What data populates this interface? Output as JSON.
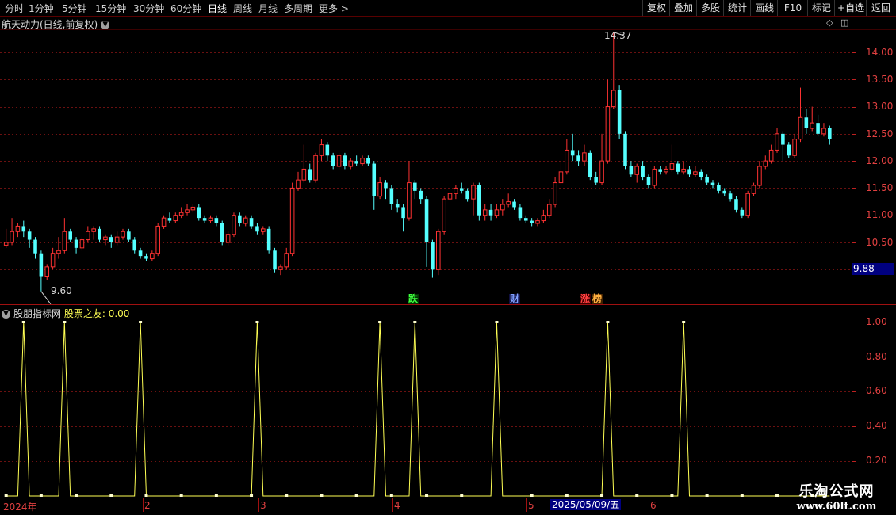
{
  "toolbar": {
    "periods": [
      "分时",
      "1分钟",
      "5分钟",
      "15分钟",
      "30分钟",
      "60分钟",
      "日线",
      "周线",
      "月线",
      "多周期",
      "更多 >"
    ],
    "active_period": "日线",
    "right_buttons": [
      "复权",
      "叠加",
      "多股",
      "统计",
      "画线",
      "F10",
      "标记",
      "+自选",
      "返回"
    ]
  },
  "main_chart": {
    "title": "航天动力(日线,前复权)",
    "price_axis": [
      "14.00",
      "13.50",
      "13.00",
      "12.50",
      "12.00",
      "11.50",
      "11.00",
      "10.50"
    ],
    "current_price": "9.88",
    "high_label": "14.37",
    "low_label": "9.60",
    "markers": [
      {
        "text": "跌",
        "color": "#40ff40",
        "bg": "#003300"
      },
      {
        "text": "财",
        "color": "#80a0ff",
        "bg": "#101040"
      },
      {
        "text": "涨",
        "color": "#ff4040",
        "bg": "#400000"
      },
      {
        "text": "榜",
        "color": "#ffb040",
        "bg": "#402000"
      }
    ]
  },
  "chart_data": [
    {
      "type": "candlestick",
      "title": "航天动力(日线,前复权)",
      "ylim": [
        9.5,
        14.5
      ],
      "up_color": "#ff3232",
      "down_color": "#54ffff",
      "candles": [
        [
          10.45,
          10.5,
          10.75,
          10.4
        ],
        [
          10.5,
          10.7,
          10.95,
          10.45
        ],
        [
          10.7,
          10.8,
          10.85,
          10.6
        ],
        [
          10.8,
          10.7,
          10.9,
          10.6
        ],
        [
          10.7,
          10.55,
          10.75,
          10.4
        ],
        [
          10.55,
          10.3,
          10.6,
          10.2
        ],
        [
          10.3,
          9.88,
          10.35,
          9.6
        ],
        [
          9.88,
          10.05,
          10.1,
          9.8
        ],
        [
          10.05,
          10.3,
          10.4,
          10.0
        ],
        [
          10.3,
          10.35,
          10.6,
          10.2
        ],
        [
          10.35,
          10.7,
          10.95,
          10.3
        ],
        [
          10.7,
          10.55,
          10.75,
          10.5
        ],
        [
          10.55,
          10.4,
          10.6,
          10.3
        ],
        [
          10.4,
          10.55,
          10.6,
          10.35
        ],
        [
          10.55,
          10.7,
          10.8,
          10.5
        ],
        [
          10.7,
          10.75,
          10.8,
          10.55
        ],
        [
          10.75,
          10.55,
          10.8,
          10.5
        ],
        [
          10.55,
          10.6,
          10.65,
          10.45
        ],
        [
          10.6,
          10.5,
          10.65,
          10.4
        ],
        [
          10.5,
          10.6,
          10.7,
          10.45
        ],
        [
          10.6,
          10.7,
          10.75,
          10.55
        ],
        [
          10.7,
          10.55,
          10.75,
          10.5
        ],
        [
          10.55,
          10.35,
          10.6,
          10.3
        ],
        [
          10.35,
          10.25,
          10.4,
          10.2
        ],
        [
          10.25,
          10.2,
          10.3,
          10.15
        ],
        [
          10.2,
          10.3,
          10.35,
          10.15
        ],
        [
          10.3,
          10.8,
          10.85,
          10.25
        ],
        [
          10.8,
          10.95,
          11.0,
          10.75
        ],
        [
          10.95,
          10.9,
          11.05,
          10.85
        ],
        [
          10.9,
          11.0,
          11.05,
          10.85
        ],
        [
          11.0,
          11.05,
          11.15,
          10.95
        ],
        [
          11.05,
          11.1,
          11.2,
          11.0
        ],
        [
          11.1,
          11.15,
          11.2,
          11.05
        ],
        [
          11.15,
          10.95,
          11.2,
          10.9
        ],
        [
          10.95,
          10.9,
          11.0,
          10.85
        ],
        [
          10.9,
          10.95,
          11.0,
          10.85
        ],
        [
          10.95,
          10.85,
          11.0,
          10.8
        ],
        [
          10.85,
          10.5,
          10.9,
          10.45
        ],
        [
          10.5,
          10.65,
          10.7,
          10.45
        ],
        [
          10.65,
          11.0,
          11.05,
          10.6
        ],
        [
          11.0,
          10.85,
          11.05,
          10.8
        ],
        [
          10.85,
          10.95,
          11.0,
          10.8
        ],
        [
          10.95,
          10.8,
          11.0,
          10.75
        ],
        [
          10.8,
          10.7,
          10.85,
          10.65
        ],
        [
          10.7,
          10.75,
          10.8,
          10.65
        ],
        [
          10.75,
          10.35,
          10.8,
          10.3
        ],
        [
          10.35,
          10.0,
          10.4,
          9.95
        ],
        [
          10.0,
          10.05,
          10.1,
          9.9
        ],
        [
          10.05,
          10.3,
          10.4,
          10.0
        ],
        [
          10.3,
          11.5,
          11.6,
          10.25
        ],
        [
          11.5,
          11.65,
          11.8,
          11.45
        ],
        [
          11.65,
          11.85,
          12.3,
          11.6
        ],
        [
          11.85,
          11.65,
          11.95,
          11.6
        ],
        [
          11.65,
          12.1,
          12.15,
          11.6
        ],
        [
          12.1,
          12.3,
          12.4,
          12.0
        ],
        [
          12.3,
          12.1,
          12.35,
          12.0
        ],
        [
          12.1,
          11.9,
          12.15,
          11.85
        ],
        [
          11.9,
          12.1,
          12.15,
          11.85
        ],
        [
          12.1,
          11.9,
          12.15,
          11.85
        ],
        [
          11.9,
          12.0,
          12.05,
          11.85
        ],
        [
          12.0,
          11.95,
          12.1,
          11.9
        ],
        [
          11.95,
          12.05,
          12.1,
          11.9
        ],
        [
          12.05,
          11.95,
          12.1,
          11.9
        ],
        [
          11.95,
          11.35,
          12.0,
          11.1
        ],
        [
          11.35,
          11.6,
          11.7,
          11.3
        ],
        [
          11.6,
          11.5,
          11.65,
          11.3
        ],
        [
          11.5,
          11.2,
          11.55,
          11.1
        ],
        [
          11.2,
          11.15,
          11.3,
          11.05
        ],
        [
          11.15,
          10.95,
          11.2,
          10.7
        ],
        [
          10.95,
          11.6,
          12.0,
          10.9
        ],
        [
          11.6,
          11.45,
          11.65,
          11.3
        ],
        [
          11.45,
          11.3,
          11.5,
          11.2
        ],
        [
          11.3,
          10.5,
          11.35,
          10.05
        ],
        [
          10.5,
          10.0,
          10.55,
          9.85
        ],
        [
          10.0,
          10.7,
          10.75,
          9.9
        ],
        [
          10.7,
          11.3,
          11.35,
          10.65
        ],
        [
          11.3,
          11.4,
          11.6,
          11.25
        ],
        [
          11.4,
          11.5,
          11.55,
          11.3
        ],
        [
          11.5,
          11.45,
          11.6,
          11.4
        ],
        [
          11.45,
          11.3,
          11.5,
          11.25
        ],
        [
          11.3,
          11.55,
          11.6,
          11.0
        ],
        [
          11.55,
          11.0,
          11.6,
          10.9
        ],
        [
          11.0,
          11.1,
          11.2,
          10.9
        ],
        [
          11.1,
          11.0,
          11.2,
          10.9
        ],
        [
          11.0,
          11.1,
          11.2,
          10.95
        ],
        [
          11.1,
          11.2,
          11.3,
          11.0
        ],
        [
          11.2,
          11.25,
          11.4,
          11.15
        ],
        [
          11.25,
          11.15,
          11.3,
          11.1
        ],
        [
          11.15,
          10.95,
          11.2,
          10.9
        ],
        [
          10.95,
          10.9,
          11.0,
          10.85
        ],
        [
          10.9,
          10.85,
          10.95,
          10.8
        ],
        [
          10.85,
          10.9,
          10.95,
          10.8
        ],
        [
          10.9,
          11.0,
          11.1,
          10.85
        ],
        [
          11.0,
          11.2,
          11.3,
          10.95
        ],
        [
          11.2,
          11.6,
          11.7,
          11.15
        ],
        [
          11.6,
          11.8,
          12.0,
          11.55
        ],
        [
          11.8,
          12.2,
          12.4,
          11.75
        ],
        [
          12.2,
          12.1,
          12.5,
          12.0
        ],
        [
          12.1,
          12.0,
          12.2,
          11.9
        ],
        [
          12.0,
          12.15,
          12.3,
          11.9
        ],
        [
          12.15,
          11.7,
          12.2,
          11.65
        ],
        [
          11.7,
          11.6,
          11.8,
          11.55
        ],
        [
          11.6,
          12.0,
          12.5,
          11.55
        ],
        [
          12.0,
          13.0,
          13.5,
          11.95
        ],
        [
          13.0,
          13.3,
          14.37,
          12.95
        ],
        [
          13.3,
          12.5,
          13.4,
          12.4
        ],
        [
          12.5,
          11.9,
          12.55,
          11.85
        ],
        [
          11.9,
          11.75,
          12.0,
          11.7
        ],
        [
          11.75,
          11.9,
          11.95,
          11.6
        ],
        [
          11.9,
          11.7,
          12.0,
          11.65
        ],
        [
          11.7,
          11.55,
          11.75,
          11.5
        ],
        [
          11.55,
          11.85,
          11.9,
          11.5
        ],
        [
          11.85,
          11.8,
          11.9,
          11.75
        ],
        [
          11.8,
          11.85,
          11.9,
          11.75
        ],
        [
          11.85,
          11.95,
          12.3,
          11.8
        ],
        [
          11.95,
          11.8,
          12.0,
          11.75
        ],
        [
          11.8,
          11.85,
          12.0,
          11.75
        ],
        [
          11.85,
          11.75,
          11.9,
          11.7
        ],
        [
          11.75,
          11.8,
          11.9,
          11.7
        ],
        [
          11.8,
          11.7,
          11.85,
          11.65
        ],
        [
          11.7,
          11.6,
          11.75,
          11.55
        ],
        [
          11.6,
          11.55,
          11.65,
          11.5
        ],
        [
          11.55,
          11.45,
          11.6,
          11.4
        ],
        [
          11.45,
          11.4,
          11.5,
          11.35
        ],
        [
          11.4,
          11.3,
          11.45,
          11.25
        ],
        [
          11.3,
          11.1,
          11.35,
          11.05
        ],
        [
          11.1,
          11.0,
          11.15,
          10.95
        ],
        [
          11.0,
          11.4,
          11.45,
          10.95
        ],
        [
          11.4,
          11.55,
          11.6,
          11.35
        ],
        [
          11.55,
          11.9,
          12.0,
          11.5
        ],
        [
          11.9,
          12.0,
          12.1,
          11.85
        ],
        [
          12.0,
          12.2,
          12.3,
          11.95
        ],
        [
          12.2,
          12.5,
          12.6,
          12.15
        ],
        [
          12.5,
          12.3,
          12.55,
          12.0
        ],
        [
          12.3,
          12.1,
          12.35,
          12.05
        ],
        [
          12.1,
          12.4,
          12.5,
          12.05
        ],
        [
          12.4,
          12.8,
          13.35,
          12.35
        ],
        [
          12.8,
          12.6,
          12.95,
          12.5
        ],
        [
          12.6,
          12.7,
          13.0,
          12.55
        ],
        [
          12.7,
          12.5,
          12.85,
          12.45
        ],
        [
          12.5,
          12.6,
          12.7,
          12.45
        ],
        [
          12.6,
          12.4,
          12.65,
          12.3
        ]
      ]
    },
    {
      "type": "line",
      "title": "股朋指标网  股票之友: 0.00",
      "ylim": [
        0,
        1.05
      ],
      "color": "#ffff54",
      "y_ticks": [
        "1.00",
        "0.80",
        "0.60",
        "0.40",
        "0.20"
      ],
      "spike_positions": [
        3,
        10,
        23,
        43,
        64,
        70,
        84,
        103,
        116
      ],
      "values": "spike"
    }
  ],
  "indicator_panel": {
    "title": "股朋指标网",
    "name": "股票之友: 0.00",
    "y_ticks": [
      "1.00",
      "0.80",
      "0.60",
      "0.40",
      "0.20"
    ]
  },
  "date_axis": {
    "labels": [
      "2024年",
      "2",
      "3",
      "4",
      "5",
      "6"
    ],
    "highlight": "2025/05/09/五"
  },
  "watermark": {
    "line1": "乐淘公式网",
    "line2": "www.60lt.com"
  }
}
